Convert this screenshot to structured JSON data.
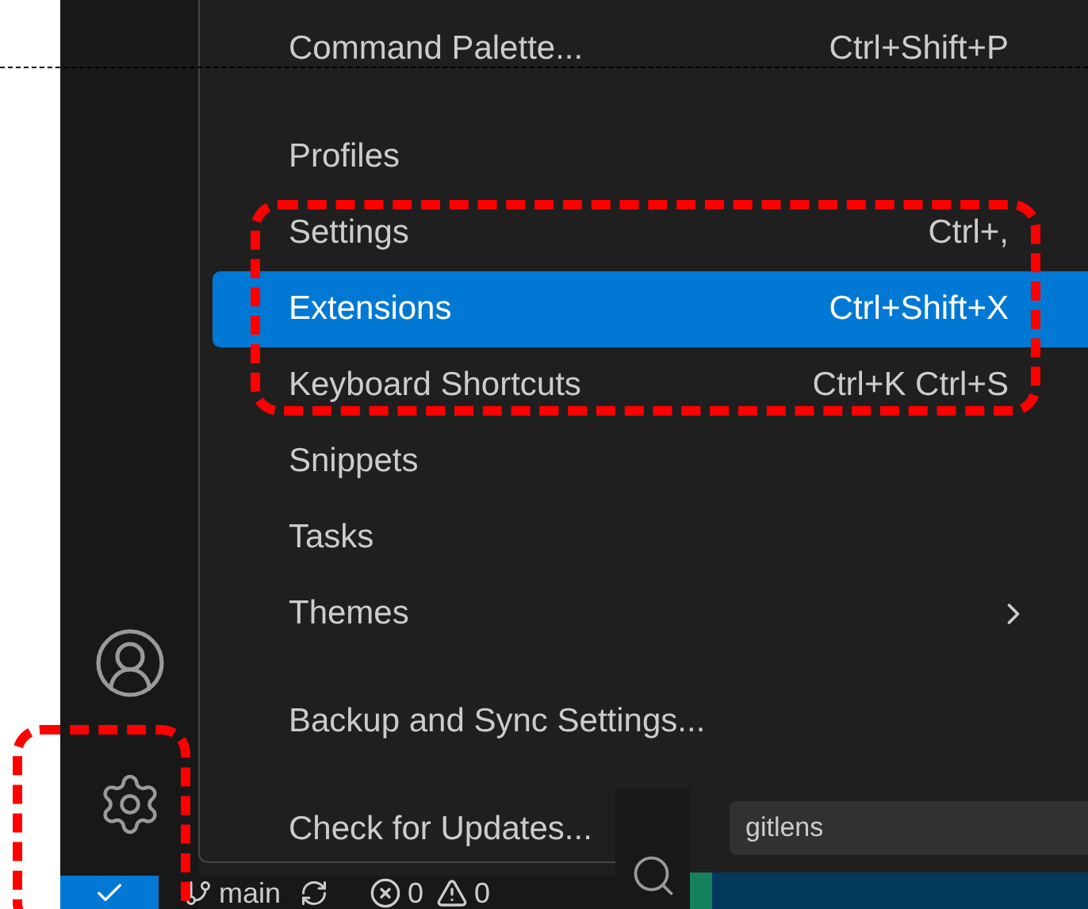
{
  "menu": {
    "items": [
      {
        "kind": "item",
        "label": "Command Palette...",
        "shortcut": "Ctrl+Shift+P",
        "selected": false
      },
      {
        "kind": "separator"
      },
      {
        "kind": "item",
        "label": "Profiles",
        "selected": false
      },
      {
        "kind": "item",
        "label": "Settings",
        "shortcut": "Ctrl+,",
        "selected": false
      },
      {
        "kind": "item",
        "label": "Extensions",
        "shortcut": "Ctrl+Shift+X",
        "selected": true
      },
      {
        "kind": "item",
        "label": "Keyboard Shortcuts",
        "shortcut": "Ctrl+K Ctrl+S",
        "selected": false
      },
      {
        "kind": "item",
        "label": "Snippets",
        "selected": false
      },
      {
        "kind": "item",
        "label": "Tasks",
        "selected": false
      },
      {
        "kind": "submenu",
        "label": "Themes",
        "selected": false
      },
      {
        "kind": "separator"
      },
      {
        "kind": "item",
        "label": "Backup and Sync Settings...",
        "selected": false
      },
      {
        "kind": "separator"
      },
      {
        "kind": "item",
        "label": "Check for Updates...",
        "selected": false
      }
    ]
  },
  "status_bar": {
    "branch": "main",
    "errors": "0",
    "warnings": "0"
  },
  "extensions_panel": {
    "search": {
      "value": "gitlens"
    }
  }
}
